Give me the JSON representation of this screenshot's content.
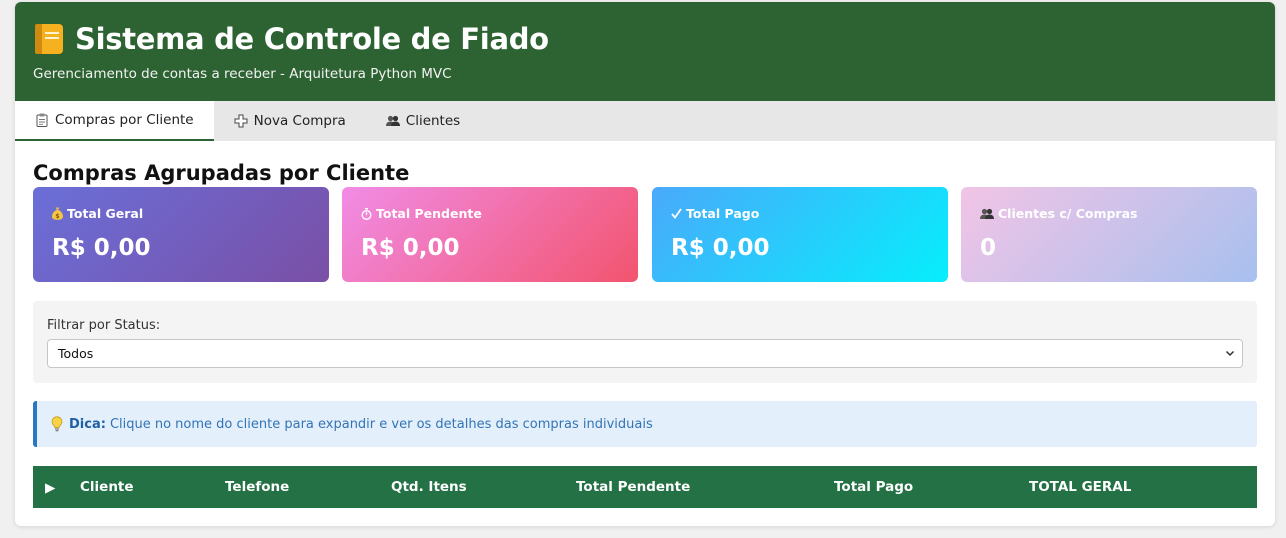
{
  "header": {
    "app_icon": "ledger-book-icon",
    "title": "Sistema de Controle de Fiado",
    "subtitle": "Gerenciamento de contas a receber - Arquitetura Python MVC"
  },
  "tabs": [
    {
      "label": "Compras por Cliente",
      "icon": "clipboard-icon",
      "active": true
    },
    {
      "label": "Nova Compra",
      "icon": "plus-icon",
      "active": false
    },
    {
      "label": "Clientes",
      "icon": "users-icon",
      "active": false
    }
  ],
  "main": {
    "section_title": "Compras Agrupadas por Cliente",
    "cards": [
      {
        "label": "Total Geral",
        "icon": "money-bag-icon",
        "value": "R$ 0,00"
      },
      {
        "label": "Total Pendente",
        "icon": "timer-icon",
        "value": "R$ 0,00"
      },
      {
        "label": "Total Pago",
        "icon": "check-icon",
        "value": "R$ 0,00"
      },
      {
        "label": "Clientes c/ Compras",
        "icon": "users-icon",
        "value": "0"
      }
    ],
    "filter": {
      "label": "Filtrar por Status:",
      "selected": "Todos"
    },
    "tip": {
      "icon": "lightbulb-icon",
      "strong": "Dica:",
      "text": "Clique no nome do cliente para expandir e ver os detalhes das compras individuais"
    },
    "table": {
      "expand_glyph": "▶",
      "columns": [
        "Cliente",
        "Telefone",
        "Qtd. Itens",
        "Total Pendente",
        "Total Pago",
        "TOTAL GERAL"
      ]
    }
  },
  "colors": {
    "header_bg": "#2d6332",
    "table_header_bg": "#237144",
    "tip_accent": "#2c77c3"
  }
}
